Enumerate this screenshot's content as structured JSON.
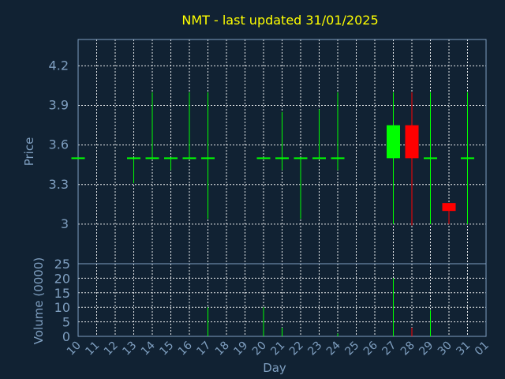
{
  "chart_data": {
    "type": "candlestick",
    "title": "NMT - last updated 31/01/2025",
    "xlabel": "Day",
    "price_panel": {
      "ylabel": "Price",
      "ylim": [
        2.7,
        4.4
      ],
      "yticks": [
        "3",
        "3.3",
        "3.6",
        "3.9",
        "4.2"
      ],
      "grid": true
    },
    "volume_panel": {
      "ylabel": "Volume (0000)",
      "ylim": [
        0,
        25
      ],
      "yticks": [
        "0",
        "5",
        "10",
        "15",
        "20",
        "25"
      ],
      "grid": true
    },
    "x_ticks": [
      "10",
      "11",
      "12",
      "13",
      "14",
      "15",
      "16",
      "17",
      "18",
      "19",
      "20",
      "21",
      "22",
      "23",
      "24",
      "25",
      "26",
      "27",
      "28",
      "29",
      "30",
      "31",
      "01"
    ],
    "candles": [
      {
        "day": "10",
        "open": 3.5,
        "high": 3.5,
        "low": 3.5,
        "close": 3.5,
        "volume": 0
      },
      {
        "day": "13",
        "open": 3.5,
        "high": 3.5,
        "low": 3.31,
        "close": 3.5,
        "volume": 0
      },
      {
        "day": "14",
        "open": 3.5,
        "high": 4.0,
        "low": 3.5,
        "close": 3.5,
        "volume": 0
      },
      {
        "day": "15",
        "open": 3.5,
        "high": 3.5,
        "low": 3.41,
        "close": 3.5,
        "volume": 0
      },
      {
        "day": "16",
        "open": 3.5,
        "high": 4.0,
        "low": 3.5,
        "close": 3.5,
        "volume": 0
      },
      {
        "day": "17",
        "open": 3.5,
        "high": 4.0,
        "low": 3.04,
        "close": 3.5,
        "volume": 10
      },
      {
        "day": "20",
        "open": 3.5,
        "high": 3.5,
        "low": 3.5,
        "close": 3.5,
        "volume": 10
      },
      {
        "day": "21",
        "open": 3.5,
        "high": 3.85,
        "low": 3.41,
        "close": 3.5,
        "volume": 3
      },
      {
        "day": "22",
        "open": 3.5,
        "high": 3.5,
        "low": 3.04,
        "close": 3.5,
        "volume": 0
      },
      {
        "day": "23",
        "open": 3.5,
        "high": 3.87,
        "low": 3.5,
        "close": 3.5,
        "volume": 0
      },
      {
        "day": "24",
        "open": 3.5,
        "high": 4.0,
        "low": 3.41,
        "close": 3.5,
        "volume": 1
      },
      {
        "day": "27",
        "open": 3.5,
        "high": 4.0,
        "low": 3.0,
        "close": 3.75,
        "volume": 20
      },
      {
        "day": "28",
        "open": 3.75,
        "high": 4.0,
        "low": 2.99,
        "close": 3.5,
        "volume": 3
      },
      {
        "day": "29",
        "open": 3.5,
        "high": 4.0,
        "low": 3.0,
        "close": 3.5,
        "volume": 9
      },
      {
        "day": "30",
        "open": 3.16,
        "high": 3.16,
        "low": 3.0,
        "close": 3.1,
        "volume": 0
      },
      {
        "day": "31",
        "open": 3.5,
        "high": 4.0,
        "low": 3.0,
        "close": 3.5,
        "volume": 0
      }
    ],
    "colors": {
      "background": "#112233",
      "up": "#00ff00",
      "down": "#ff0000",
      "title": "#ffff00",
      "axis": "#7f9fc0",
      "grid": "#ffffff"
    }
  }
}
